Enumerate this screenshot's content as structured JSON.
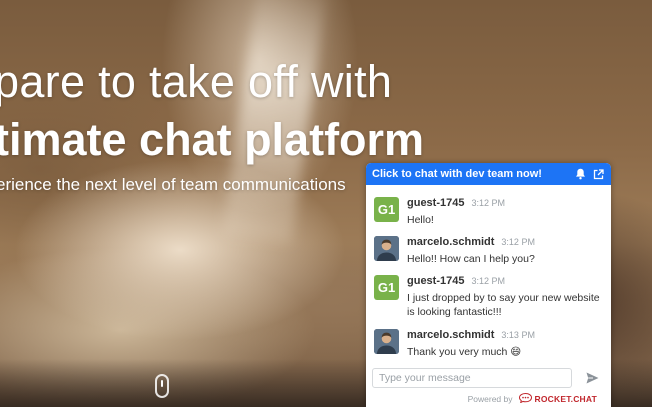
{
  "hero": {
    "line1": "pare to take off with",
    "line2": "timate chat platform",
    "line3": "erience the next level of team communications"
  },
  "widget": {
    "header": "Click to chat with dev team now!",
    "icons": {
      "notify": "bell-icon",
      "popout": "external-link-icon"
    },
    "messages": [
      {
        "avatar": "G1",
        "name": "guest-1745",
        "time": "3:12 PM",
        "text": "Hello!"
      },
      {
        "avatar": "photo",
        "name": "marcelo.schmidt",
        "time": "3:12 PM",
        "text": "Hello!! How can I help you?"
      },
      {
        "avatar": "G1",
        "name": "guest-1745",
        "time": "3:12 PM",
        "text": "I just dropped by to say your new website is looking fantastic!!!"
      },
      {
        "avatar": "photo",
        "name": "marcelo.schmidt",
        "time": "3:13 PM",
        "text": "Thank you very much 😄"
      }
    ],
    "placeholder": "Type your message",
    "powered_by": "Powered by",
    "brand": "ROCKET.CHAT",
    "colors": {
      "header": "#1d74f5",
      "guest_avatar": "#79b24a",
      "brand": "#c1272d"
    }
  }
}
